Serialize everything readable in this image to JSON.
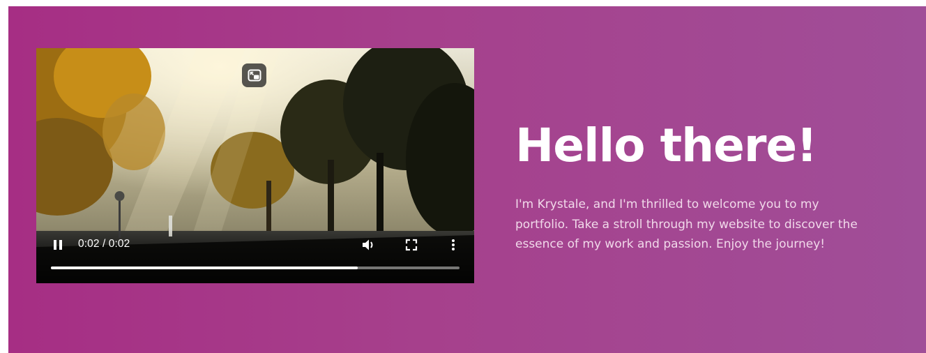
{
  "video": {
    "current_time": "0:02",
    "duration": "0:02",
    "time_display": "0:02 / 0:02",
    "progress": 0.75,
    "state": "playing",
    "icons": {
      "pip": "picture-in-picture-icon",
      "pause": "pause-icon",
      "volume": "volume-icon",
      "fullscreen": "fullscreen-icon",
      "more": "more-options-icon"
    }
  },
  "hero": {
    "headline": "Hello there!",
    "intro": "I'm Krystale, and I'm thrilled to welcome you to my portfolio. Take a stroll through my website to discover the essence of my work and passion. Enjoy the journey!"
  },
  "colors": {
    "background_start": "#a62e84",
    "background_end": "#a04e98",
    "headline": "#ffffff",
    "body_text": "#f1d9ea"
  }
}
